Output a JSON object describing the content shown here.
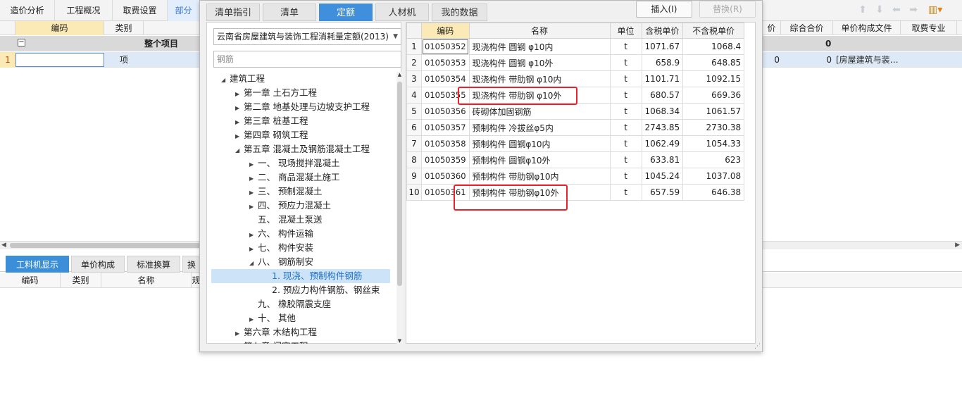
{
  "main_tabs": [
    {
      "label": "造价分析",
      "active": false
    },
    {
      "label": "工程概况",
      "active": false
    },
    {
      "label": "取费设置",
      "active": false
    },
    {
      "label": "部分",
      "active": true
    }
  ],
  "grid": {
    "headers_left": [
      "编码",
      "类别"
    ],
    "headers_right": [
      "价",
      "综合合价",
      "单价构成文件",
      "取费专业"
    ],
    "group_row": {
      "label": "整个项目",
      "total": "0"
    },
    "item_row": {
      "index": "1",
      "type": "项",
      "price": "0",
      "total": "0",
      "file": "[房屋建筑与装…"
    }
  },
  "bottom": {
    "tabs": [
      {
        "label": "工料机显示",
        "active": true
      },
      {
        "label": "单价构成",
        "active": false
      },
      {
        "label": "标准换算",
        "active": false
      },
      {
        "label": "换",
        "active": false
      }
    ],
    "headers": [
      "编码",
      "类别",
      "名称",
      "规"
    ]
  },
  "dialog": {
    "tabs": [
      {
        "label": "清单指引",
        "active": false
      },
      {
        "label": "清单",
        "active": false
      },
      {
        "label": "定额",
        "active": true
      },
      {
        "label": "人材机",
        "active": false
      },
      {
        "label": "我的数据",
        "active": false
      }
    ],
    "insert_button": "插入(I)",
    "replace_button": "替换(R)",
    "library": "云南省房屋建筑与装饰工程消耗量定额(2013)",
    "search_value": "钢筋",
    "tree": [
      {
        "label": "建筑工程",
        "level": 0,
        "arrow": "open"
      },
      {
        "label": "第一章 土石方工程",
        "level": 1,
        "arrow": "closed"
      },
      {
        "label": "第二章 地基处理与边坡支护工程",
        "level": 1,
        "arrow": "closed"
      },
      {
        "label": "第三章 桩基工程",
        "level": 1,
        "arrow": "closed"
      },
      {
        "label": "第四章 砌筑工程",
        "level": 1,
        "arrow": "closed"
      },
      {
        "label": "第五章 混凝土及钢筋混凝土工程",
        "level": 1,
        "arrow": "open"
      },
      {
        "label": "一、 现场搅拌混凝土",
        "level": 2,
        "arrow": "closed"
      },
      {
        "label": "二、 商品混凝土施工",
        "level": 2,
        "arrow": "closed"
      },
      {
        "label": "三、 预制混凝土",
        "level": 2,
        "arrow": "closed"
      },
      {
        "label": "四、 预应力混凝土",
        "level": 2,
        "arrow": "closed"
      },
      {
        "label": "五、 混凝土泵送",
        "level": 2,
        "arrow": "none"
      },
      {
        "label": "六、 构件运输",
        "level": 2,
        "arrow": "closed"
      },
      {
        "label": "七、 构件安装",
        "level": 2,
        "arrow": "closed"
      },
      {
        "label": "八、 钢筋制安",
        "level": 2,
        "arrow": "open"
      },
      {
        "label": "1. 现浇、预制构件钢筋",
        "level": 3,
        "arrow": "none",
        "selected": true
      },
      {
        "label": "2. 预应力构件钢筋、钢丝束",
        "level": 3,
        "arrow": "none"
      },
      {
        "label": "九、 橡胶隔震支座",
        "level": 2,
        "arrow": "none"
      },
      {
        "label": "十、 其他",
        "level": 2,
        "arrow": "closed"
      },
      {
        "label": "第六章 木结构工程",
        "level": 1,
        "arrow": "closed"
      },
      {
        "label": "第七章 门窗工程",
        "level": 1,
        "arrow": "closed"
      }
    ],
    "table": {
      "headers": [
        "",
        "编码",
        "名称",
        "单位",
        "含税单价",
        "不含税单价"
      ],
      "rows": [
        {
          "num": "1",
          "code": "01050352",
          "name": "现浇构件 圆钢 φ10内",
          "unit": "t",
          "tax_price": "1071.67",
          "price": "1068.4"
        },
        {
          "num": "2",
          "code": "01050353",
          "name": "现浇构件 圆钢 φ10外",
          "unit": "t",
          "tax_price": "658.9",
          "price": "648.85"
        },
        {
          "num": "3",
          "code": "01050354",
          "name": "现浇构件 带肋钢 φ10内",
          "unit": "t",
          "tax_price": "1101.71",
          "price": "1092.15"
        },
        {
          "num": "4",
          "code": "01050355",
          "name": "现浇构件 带肋钢 φ10外",
          "unit": "t",
          "tax_price": "680.57",
          "price": "669.36"
        },
        {
          "num": "5",
          "code": "01050356",
          "name": "砖砌体加固钢筋",
          "unit": "t",
          "tax_price": "1068.34",
          "price": "1061.57"
        },
        {
          "num": "6",
          "code": "01050357",
          "name": "预制构件 冷拔丝φ5内",
          "unit": "t",
          "tax_price": "2743.85",
          "price": "2730.38"
        },
        {
          "num": "7",
          "code": "01050358",
          "name": "预制构件 圆钢φ10内",
          "unit": "t",
          "tax_price": "1062.49",
          "price": "1054.33"
        },
        {
          "num": "8",
          "code": "01050359",
          "name": "预制构件 圆钢φ10外",
          "unit": "t",
          "tax_price": "633.81",
          "price": "623"
        },
        {
          "num": "9",
          "code": "01050360",
          "name": "预制构件 带肋钢φ10内",
          "unit": "t",
          "tax_price": "1045.24",
          "price": "1037.08"
        },
        {
          "num": "10",
          "code": "01050361",
          "name": "预制构件 带肋钢φ10外",
          "unit": "t",
          "tax_price": "657.59",
          "price": "646.38"
        }
      ]
    }
  }
}
